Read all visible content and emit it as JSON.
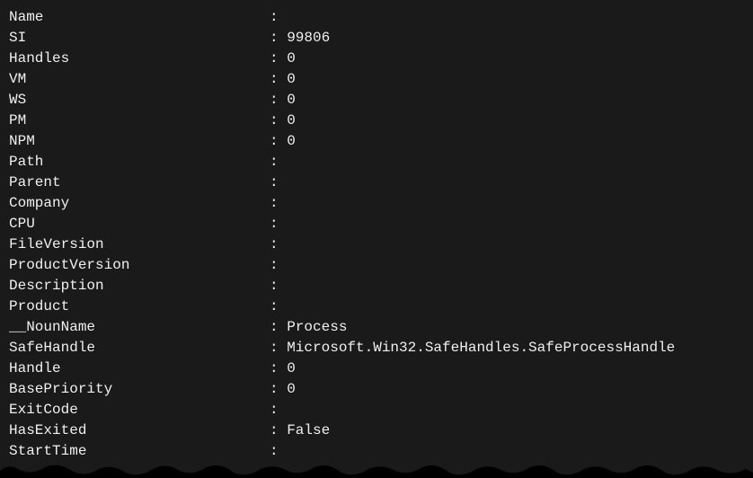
{
  "properties": [
    {
      "key": "Name",
      "value": ""
    },
    {
      "key": "SI",
      "value": "99806"
    },
    {
      "key": "Handles",
      "value": "0"
    },
    {
      "key": "VM",
      "value": "0"
    },
    {
      "key": "WS",
      "value": "0"
    },
    {
      "key": "PM",
      "value": "0"
    },
    {
      "key": "NPM",
      "value": "0"
    },
    {
      "key": "Path",
      "value": ""
    },
    {
      "key": "Parent",
      "value": ""
    },
    {
      "key": "Company",
      "value": ""
    },
    {
      "key": "CPU",
      "value": ""
    },
    {
      "key": "FileVersion",
      "value": ""
    },
    {
      "key": "ProductVersion",
      "value": ""
    },
    {
      "key": "Description",
      "value": ""
    },
    {
      "key": "Product",
      "value": ""
    },
    {
      "key": "__NounName",
      "value": "Process"
    },
    {
      "key": "SafeHandle",
      "value": "Microsoft.Win32.SafeHandles.SafeProcessHandle"
    },
    {
      "key": "Handle",
      "value": "0"
    },
    {
      "key": "BasePriority",
      "value": "0"
    },
    {
      "key": "ExitCode",
      "value": ""
    },
    {
      "key": "HasExited",
      "value": "False"
    },
    {
      "key": "StartTime",
      "value": ""
    }
  ],
  "separator": ": "
}
